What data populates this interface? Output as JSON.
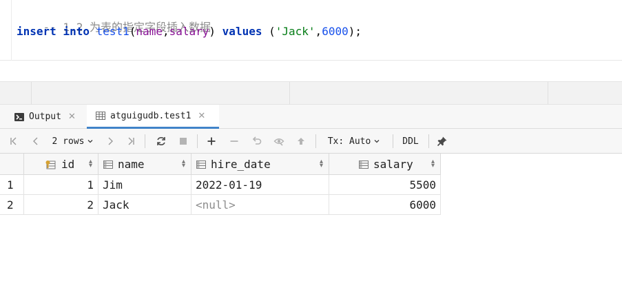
{
  "editor": {
    "comment": "-- 1.2 为表的指定字段插入数据",
    "sql": {
      "kw_insert": "insert",
      "kw_into": "into",
      "table": "test1",
      "open_paren": "(",
      "col1": "name",
      "comma1": ",",
      "col2": "salary",
      "close_paren": ")",
      "kw_values": "values",
      "vals_open": "(",
      "str_val": "'Jack'",
      "comma2": ",",
      "num_val": "6000",
      "vals_close": ");"
    }
  },
  "tabs": [
    {
      "label": "Output",
      "icon": "console-icon",
      "active": false
    },
    {
      "label": "atguigudb.test1",
      "icon": "table-icon",
      "active": true
    }
  ],
  "toolbar": {
    "rows_label": "2 rows",
    "tx_label": "Tx: Auto",
    "ddl_label": "DDL"
  },
  "grid": {
    "columns": [
      {
        "name": "id",
        "icon": "key-column-icon"
      },
      {
        "name": "name",
        "icon": "column-icon"
      },
      {
        "name": "hire_date",
        "icon": "column-icon"
      },
      {
        "name": "salary",
        "icon": "column-icon"
      }
    ],
    "rows": [
      {
        "rownum": "1",
        "id": "1",
        "name": "Jim",
        "hire_date": "2022-01-19",
        "salary": "5500"
      },
      {
        "rownum": "2",
        "id": "2",
        "name": "Jack",
        "hire_date": "<null>",
        "salary": "6000"
      }
    ]
  },
  "colors": {
    "keyword": "#0033b3",
    "string": "#067d17",
    "number": "#1750eb",
    "comment": "#8c8c8c",
    "accent": "#4083c9"
  }
}
